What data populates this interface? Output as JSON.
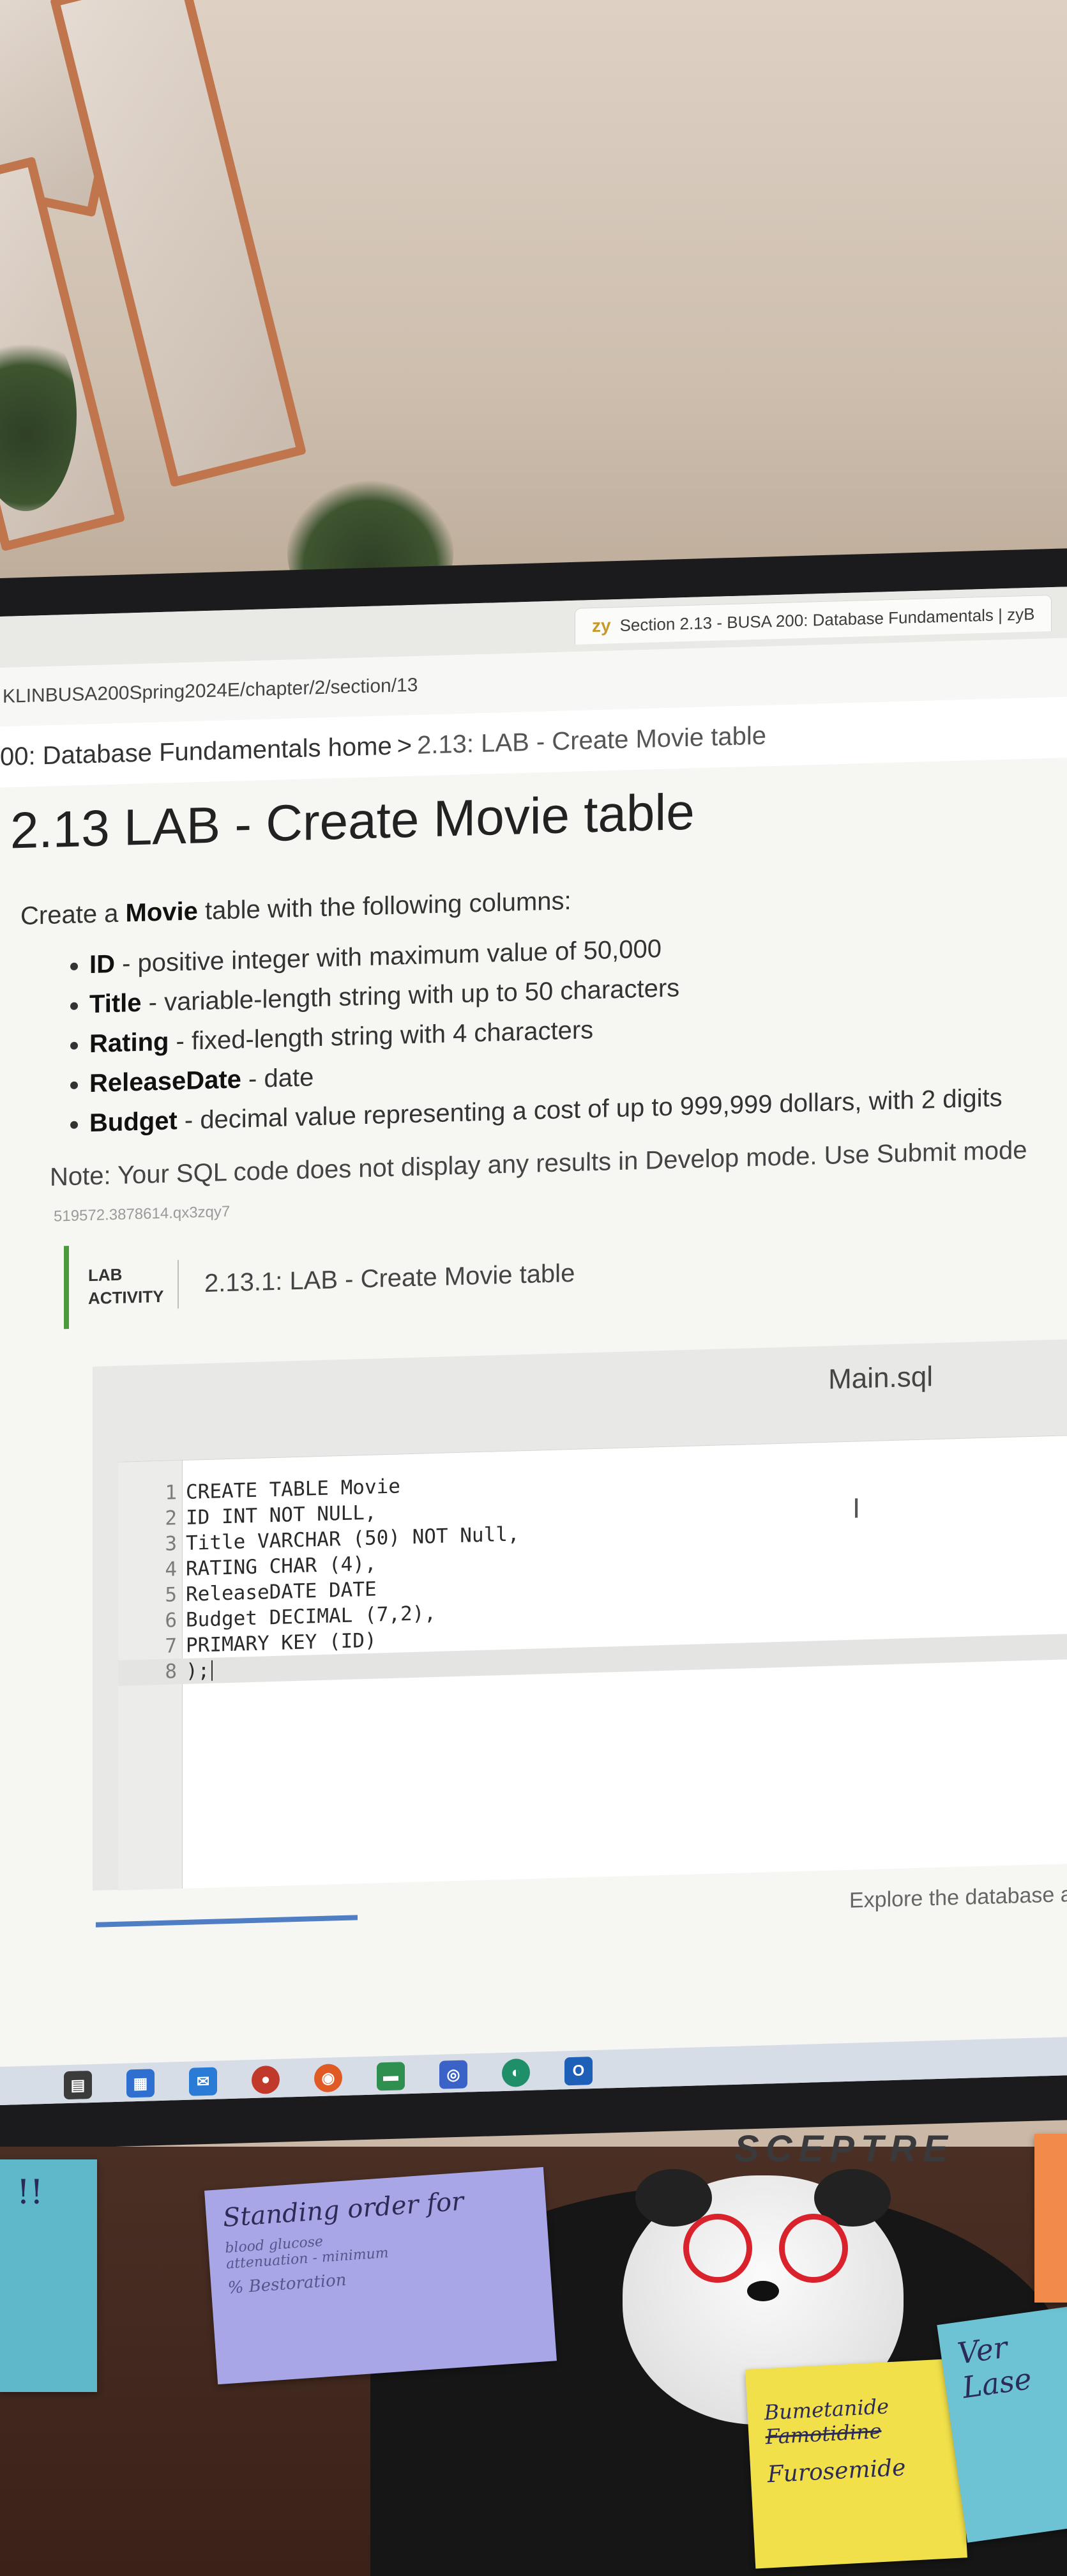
{
  "browser": {
    "tab_logo": "zy",
    "tab_title": "Section 2.13 - BUSA 200: Database Fundamentals | zyB",
    "url": "KLINBUSA200Spring2024E/chapter/2/section/13"
  },
  "breadcrumb": {
    "home": "00: Database Fundamentals home",
    "separator": ">",
    "current": "2.13: LAB - Create Movie table"
  },
  "page": {
    "title": "2.13 LAB - Create Movie table",
    "intro_prefix": "Create a ",
    "intro_bold": "Movie",
    "intro_suffix": " table with the following columns:",
    "columns": [
      {
        "name": "ID",
        "desc": " - positive integer with maximum value of 50,000"
      },
      {
        "name": "Title",
        "desc": " - variable-length string with up to 50 characters"
      },
      {
        "name": "Rating",
        "desc": " - fixed-length string with 4 characters"
      },
      {
        "name": "ReleaseDate",
        "desc": " - date"
      },
      {
        "name": "Budget",
        "desc": " - decimal value representing a cost of up to 999,999 dollars, with 2 digits"
      }
    ],
    "note": "Note: Your SQL code does not display any results in Develop mode. Use Submit mode",
    "hash": "519572.3878614.qx3zqy7"
  },
  "lab": {
    "badge_line1": "LAB",
    "badge_line2": "ACTIVITY",
    "title": "2.13.1: LAB - Create Movie table",
    "file_name": "Main.sql",
    "cursor_glyph": "I",
    "code": [
      {
        "n": "1",
        "text": "CREATE TABLE Movie"
      },
      {
        "n": "2",
        "text": "ID INT NOT NULL,"
      },
      {
        "n": "3",
        "text": "Title VARCHAR (50) NOT Null,"
      },
      {
        "n": "4",
        "text": "RATING CHAR (4),"
      },
      {
        "n": "5",
        "text": "ReleaseDATE DATE"
      },
      {
        "n": "6",
        "text": "Budget DECIMAL (7,2),"
      },
      {
        "n": "7",
        "text": "PRIMARY KEY (ID)"
      },
      {
        "n": "8",
        "text": ");"
      }
    ],
    "below_text": "Explore the database and run your program as often as"
  },
  "taskbar": {
    "icons": [
      "widgets-icon",
      "calendar-icon",
      "mail-icon",
      "media-icon",
      "chrome-icon",
      "files-icon",
      "teams-icon",
      "edge-icon",
      "outlook-icon"
    ],
    "colors": [
      "#3b3b3b",
      "#2e6fcf",
      "#2a7bd6",
      "#c0392b",
      "#e05a26",
      "#2f8f4e",
      "#3a62c7",
      "#1f8f6a",
      "#1e5fb8"
    ]
  },
  "monitor": {
    "brand": "SCEPTRE"
  },
  "stickies": {
    "purple_line1": "Standing order for",
    "purple_line2": "blood glucose",
    "purple_line3": "attenuation - minimum",
    "purple_line4": "% Bestoration",
    "yellow_line1": "Bumetanide",
    "yellow_line2": "Famotidine",
    "yellow_line3": "Furosemide",
    "blue_left": "!!",
    "blue_right_line1": "Ver",
    "blue_right_line2": "Lase"
  }
}
